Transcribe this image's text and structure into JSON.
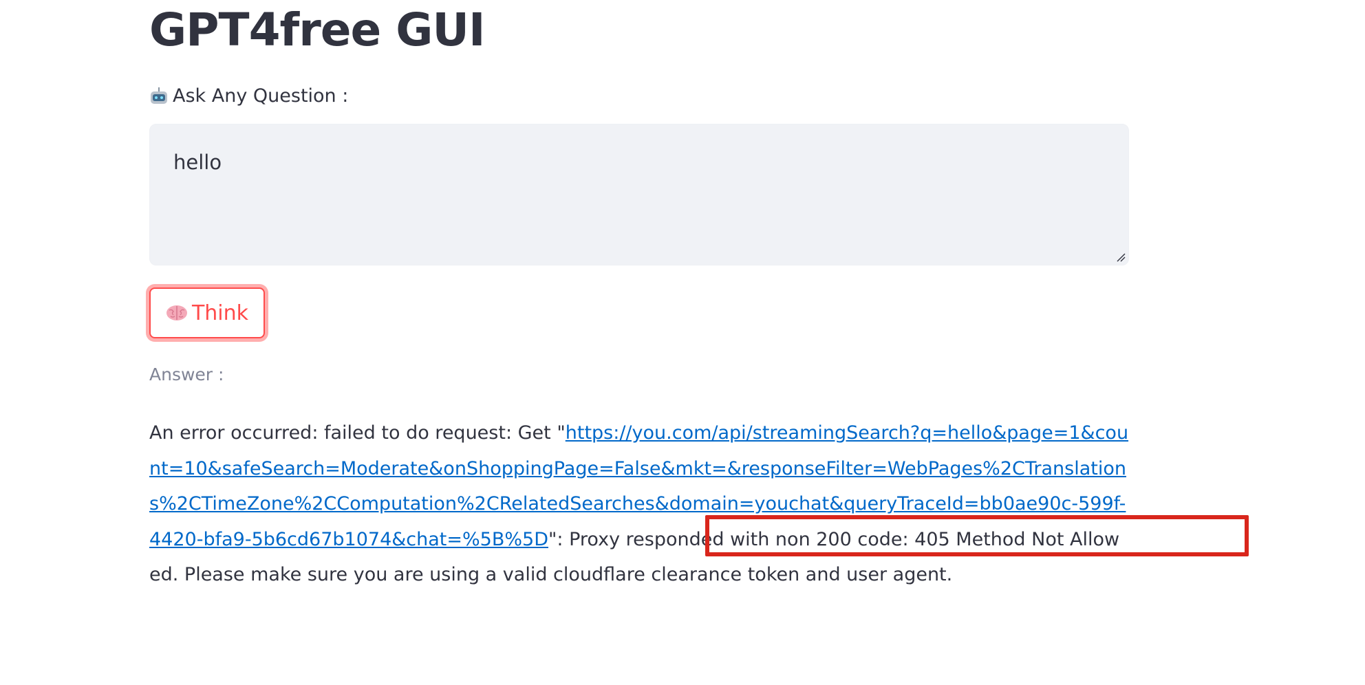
{
  "app": {
    "title": "GPT4free GUI"
  },
  "question": {
    "label": "Ask Any Question :",
    "label_icon": "robot-icon",
    "value": "hello"
  },
  "think_button": {
    "label": "Think",
    "icon": "brain-icon",
    "accent_color": "#ff4b4b"
  },
  "answer": {
    "label": "Answer :",
    "prefix": "An error occurred: failed to do request: Get \"",
    "url": "https://you.com/api/streamingSearch?q=hello&page=1&count=10&safeSearch=Moderate&onShoppingPage=False&mkt=&responseFilter=WebPages%2CTranslations%2CTimeZone%2CComputation%2CRelatedSearches&domain=youchat&queryTraceId=bb0ae90c-599f-4420-bfa9-5b6cd67b1074&chat=%5B%5D",
    "suffix": "\": Proxy responded with non 200 code: 405 Method Not Allowed. Please make sure you are using a valid cloudflare clearance token and user agent.",
    "link_color": "#0068c9"
  },
  "annotation": {
    "highlight_color": "#d9261c"
  }
}
